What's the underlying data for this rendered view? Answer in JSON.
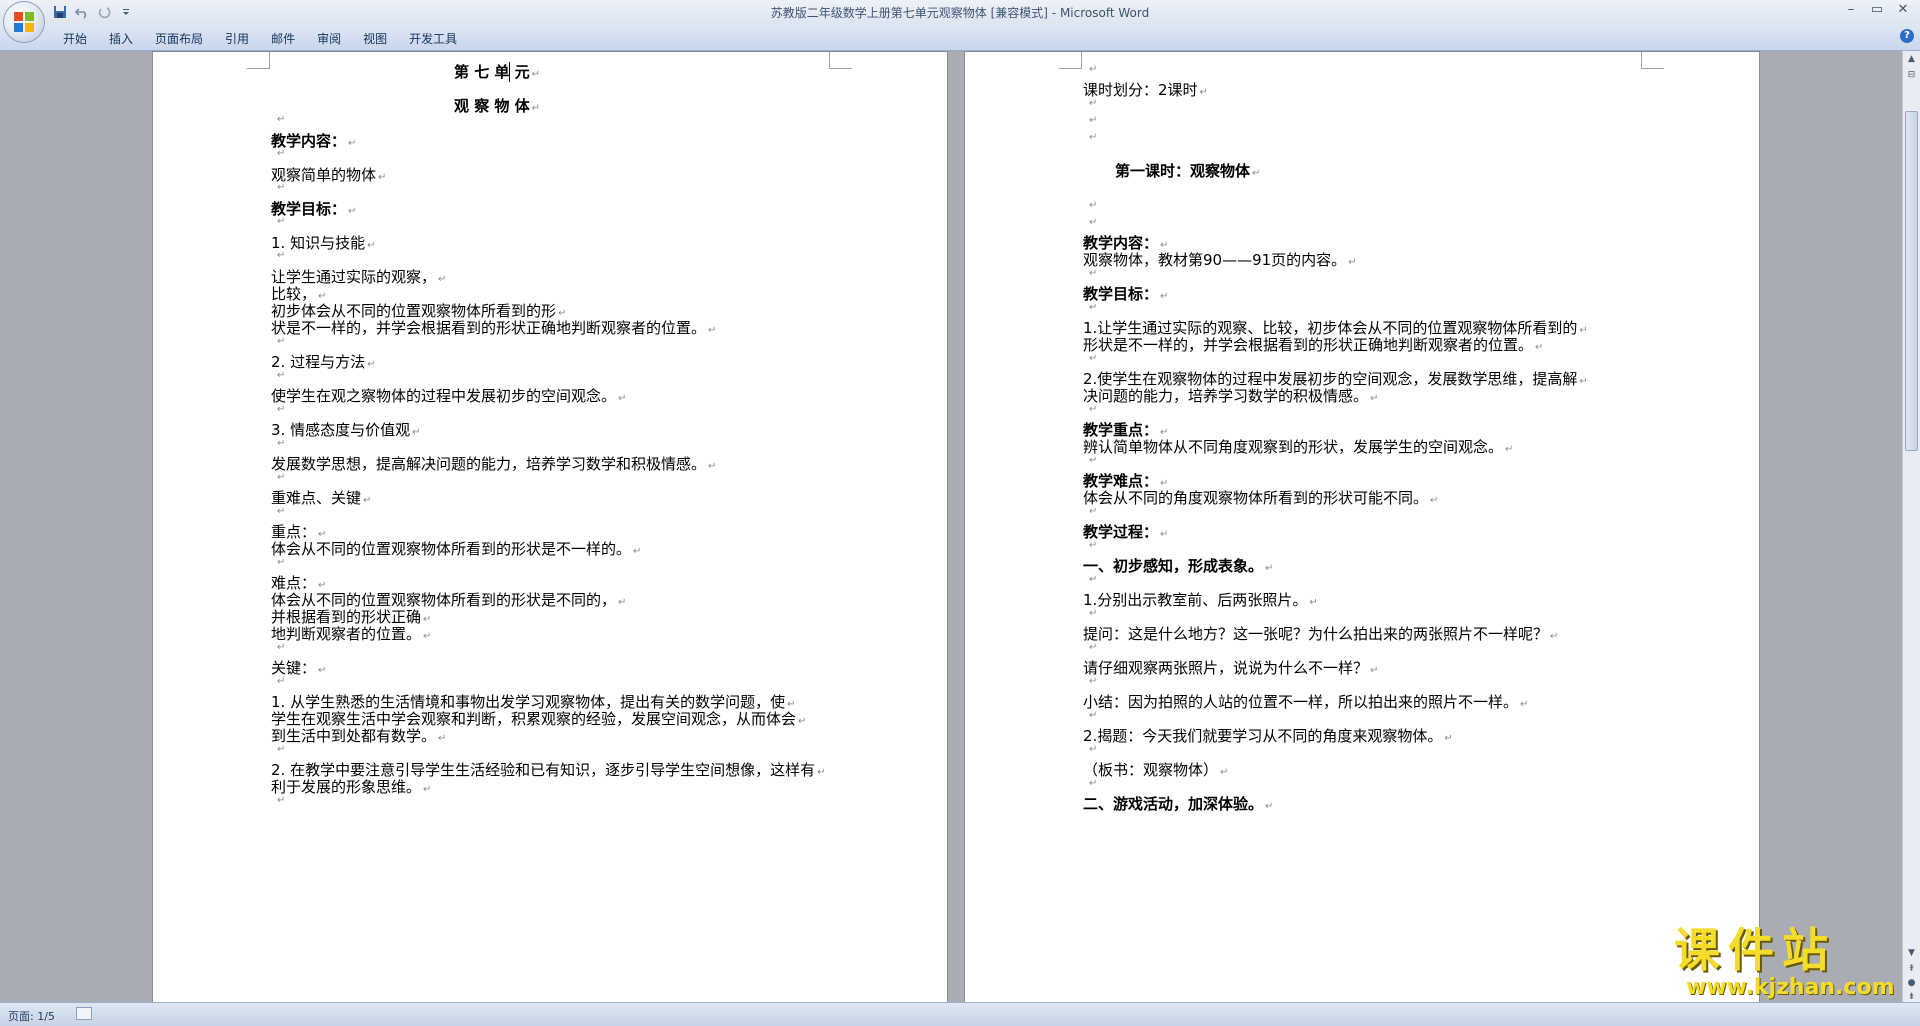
{
  "window": {
    "title": "苏教版二年级数学上册第七单元观察物体 [兼容模式]",
    "app_name": "Microsoft Word",
    "minimize": "–",
    "restore": "▭",
    "close": "✕"
  },
  "ribbon": {
    "tabs": [
      "开始",
      "插入",
      "页面布局",
      "引用",
      "邮件",
      "审阅",
      "视图",
      "开发工具"
    ]
  },
  "page1": {
    "lines": [
      {
        "text": "第 七 单 元",
        "bold": true,
        "center": true
      },
      {
        "text": "观 察 物 体",
        "bold": true,
        "center": true
      },
      {
        "text": "教学内容：",
        "bold": true
      },
      {
        "text": "观察简单的物体"
      },
      {
        "text": "教学目标：",
        "bold": true
      },
      {
        "text": "1.  知识与技能"
      },
      {
        "text": "让学生通过实际的观察，"
      },
      {
        "text": "比较，"
      },
      {
        "text": "初步体会从不同的位置观察物体所看到的形"
      },
      {
        "text": "状是不一样的，并学会根据看到的形状正确地判断观察者的位置。"
      },
      {
        "text": "2.  过程与方法"
      },
      {
        "text": "使学生在观之察物体的过程中发展初步的空间观念。"
      },
      {
        "text": "3.  情感态度与价值观"
      },
      {
        "text": "发展数学思想，提高解决问题的能力，培养学习数学和积极情感。"
      },
      {
        "text": "重难点、关键"
      },
      {
        "text": "重点："
      },
      {
        "text": "体会从不同的位置观察物体所看到的形状是不一样的。"
      },
      {
        "text": "难点："
      },
      {
        "text": "体会从不同的位置观察物体所看到的形状是不同的，"
      },
      {
        "text": "并根据看到的形状正确"
      },
      {
        "text": "地判断观察者的位置。"
      },
      {
        "text": "关键："
      },
      {
        "text": "1.  从学生熟悉的生活情境和事物出发学习观察物体，提出有关的数学问题，使"
      },
      {
        "text": "学生在观察生活中学会观察和判断，积累观察的经验，发展空间观念，从而体会"
      },
      {
        "text": "到生活中到处都有数学。"
      },
      {
        "text": "2.  在教学中要注意引导学生生活经验和已有知识，逐步引导学生空间想像，这样有"
      },
      {
        "text": "利于发展的形象思维。"
      }
    ]
  },
  "page2": {
    "lines": [
      {
        "text": "课时划分：2课时"
      },
      {
        "text": "第一课时：观察物体",
        "bold": true
      },
      {
        "text": "教学内容：",
        "bold": true
      },
      {
        "text": "观察物体，教材第90——91页的内容。"
      },
      {
        "text": "教学目标：",
        "bold": true
      },
      {
        "text": "1.让学生通过实际的观察、比较，初步体会从不同的位置观察物体所看到的"
      },
      {
        "text": "形状是不一样的，并学会根据看到的形状正确地判断观察者的位置。"
      },
      {
        "text": "2.使学生在观察物体的过程中发展初步的空间观念，发展数学思维，提高解"
      },
      {
        "text": "决问题的能力，培养学习数学的积极情感。"
      },
      {
        "text": "教学重点：",
        "bold": true
      },
      {
        "text": "辨认简单物体从不同角度观察到的形状，发展学生的空间观念。"
      },
      {
        "text": "教学难点：",
        "bold": true
      },
      {
        "text": "体会从不同的角度观察物体所看到的形状可能不同。"
      },
      {
        "text": "教学过程：",
        "bold": true
      },
      {
        "text": "一、初步感知，形成表象。",
        "bold": true
      },
      {
        "text": "1.分别出示教室前、后两张照片。"
      },
      {
        "text": "提问：这是什么地方？这一张呢？为什么拍出来的两张照片不一样呢？"
      },
      {
        "text": "请仔细观察两张照片，说说为什么不一样？"
      },
      {
        "text": "小结：因为拍照的人站的位置不一样，所以拍出来的照片不一样。"
      },
      {
        "text": "2.揭题：今天我们就要学习从不同的角度来观察物体。"
      },
      {
        "text": "（板书：观察物体）"
      },
      {
        "text": "二、游戏活动，加深体验。",
        "bold": true
      }
    ]
  },
  "status": {
    "page_indicator": "页面: 1/5"
  },
  "watermark": {
    "line1": "课件站",
    "line2": "www.kjzhan.com"
  },
  "colors": {
    "ribbon_bg": "#c9d7ec",
    "workspace_bg": "#a9acb3",
    "watermark_yellow": "#f4dc2a",
    "formatting_mark": "#8a8a8a"
  },
  "icons": [
    "office-button-icon",
    "save-icon",
    "undo-icon",
    "redo-icon",
    "customize-qat-icon",
    "help-icon",
    "spelling-check-icon"
  ]
}
